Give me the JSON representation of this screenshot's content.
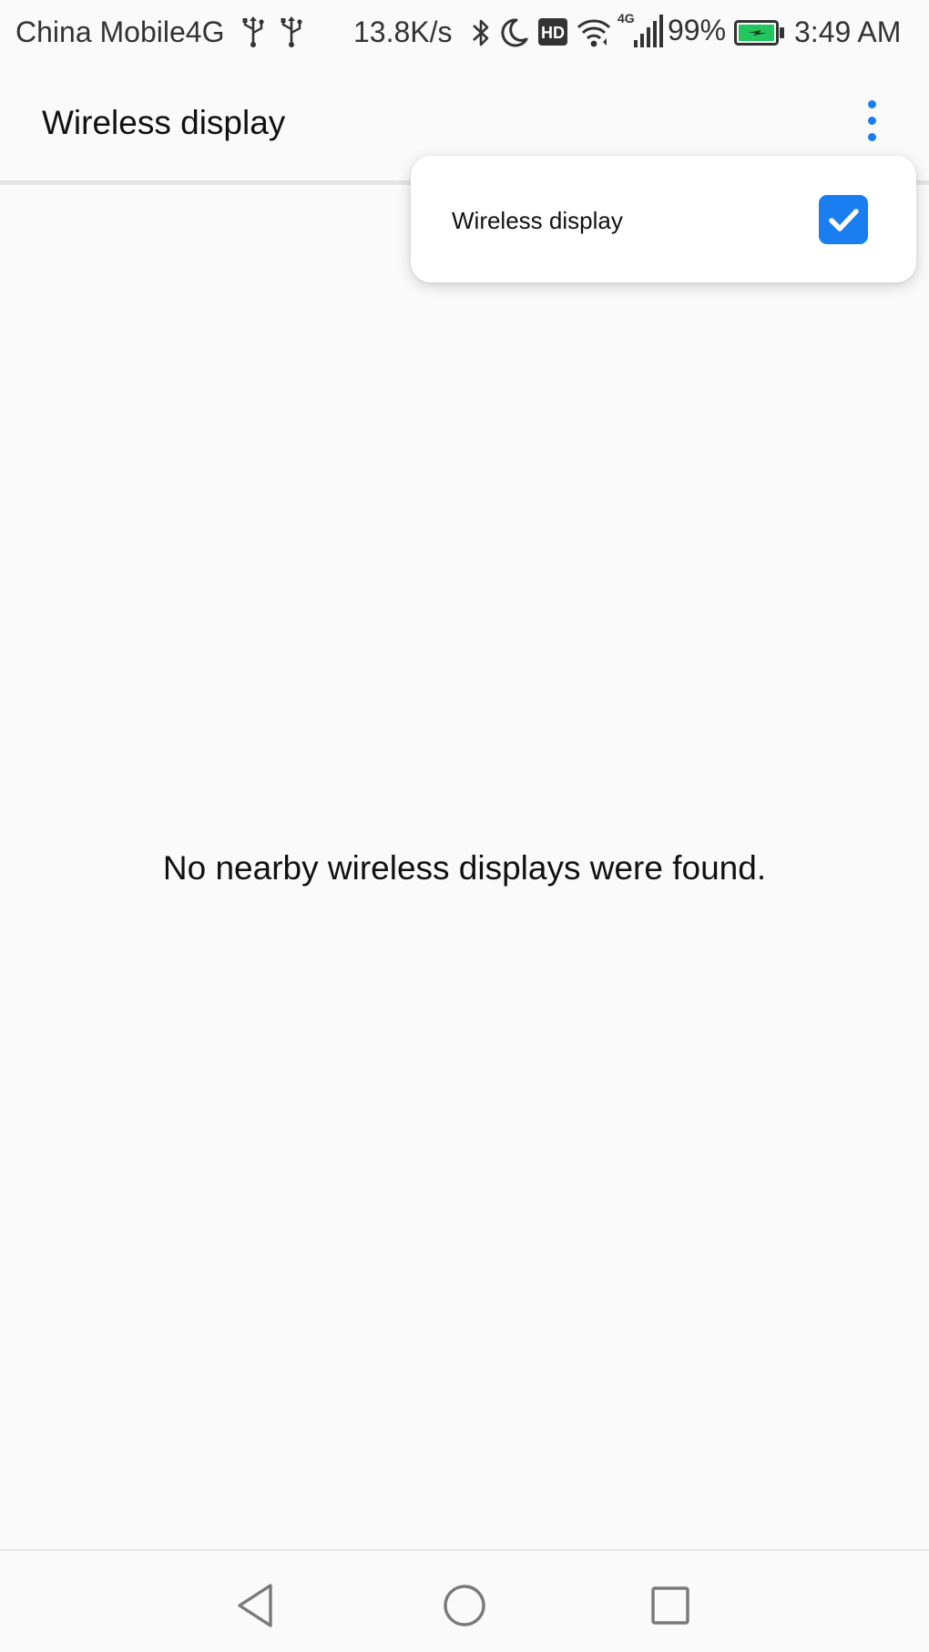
{
  "status_bar": {
    "carrier": "China Mobile4G",
    "network_speed": "13.8K/s",
    "network_type": "4G",
    "hd_badge": "HD",
    "battery_percent": "99%",
    "time": "3:49 AM",
    "icons": [
      "usb-icon",
      "usb-icon",
      "bluetooth-icon",
      "moon-icon",
      "hd-icon",
      "wifi-icon",
      "signal-icon",
      "battery-icon"
    ],
    "battery_color": "#22c55e"
  },
  "app_bar": {
    "title": "Wireless display",
    "overflow_icon": "more-vert-icon"
  },
  "popup_menu": {
    "items": [
      {
        "label": "Wireless display",
        "checked": true
      }
    ]
  },
  "main": {
    "empty_message": "No nearby wireless displays were found."
  },
  "nav_bar": {
    "buttons": [
      "back-icon",
      "home-icon",
      "recents-icon"
    ]
  },
  "colors": {
    "accent": "#1a7ef0",
    "background": "#fafafa",
    "text": "#111111"
  }
}
